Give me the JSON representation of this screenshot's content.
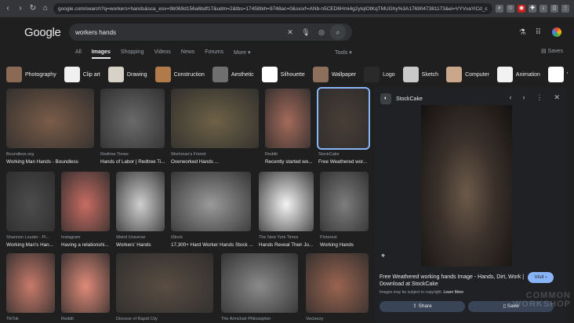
{
  "browser": {
    "url": "google.com/search?q=workers+hands&sca_esv=9b069d156a6bdf17&udm=2&tbs=17458bih=9748ac=0&sxsrf=ANb-n5CED6Hmi4g2yIqIOtKqTMUGhy%3A1769047381173&ei=VYVvaYiCd_ckPIP_pcCAo&ved=0ahUKEwjKx_"
  },
  "header": {
    "logo": "Google",
    "search_query": "workers hands"
  },
  "tabs": [
    "All",
    "Images",
    "Shopping",
    "Videos",
    "News",
    "Forums",
    "More"
  ],
  "tools_label": "Tools",
  "saves_label": "Saves",
  "chips": [
    {
      "label": "Photography",
      "color": "#8a6a55"
    },
    {
      "label": "Clip art",
      "color": "#f0f0f0"
    },
    {
      "label": "Drawing",
      "color": "#d6d2c8"
    },
    {
      "label": "Construction",
      "color": "#b07a4a"
    },
    {
      "label": "Aesthetic",
      "color": "#6f6f6f"
    },
    {
      "label": "Silhouette",
      "color": "#ffffff"
    },
    {
      "label": "Wallpaper",
      "color": "#8c6f5c"
    },
    {
      "label": "Logo",
      "color": "#2a2a2a"
    },
    {
      "label": "Sketch",
      "color": "#c9c9c9"
    },
    {
      "label": "Computer",
      "color": "#caa68a"
    },
    {
      "label": "Animation",
      "color": "#f2f2f2"
    },
    {
      "label": "Vecto",
      "color": "#ffffff"
    }
  ],
  "results": [
    {
      "source": "Boundless.org",
      "title": "Working Man Hands - Boundless",
      "color": "#7a5c48"
    },
    {
      "source": "Redtree Times",
      "title": "Hands of Labor | Redtree Ti...",
      "color": "#6a6a6a"
    },
    {
      "source": "Workman's Friend",
      "title": "Overworked Hands ...",
      "color": "#6e6146"
    },
    {
      "source": "Reddit",
      "title": "Recently started wo...",
      "color": "#a46a5a"
    },
    {
      "source": "StockCake",
      "title": "Free Weathered wor...",
      "color": "#4a3e36"
    },
    {
      "source": "Shannon Louder - Pi...",
      "title": "Working Man's Han...",
      "color": "#4c4c4c"
    },
    {
      "source": "Instagram",
      "title": "Having a relationshi...",
      "color": "#c86c62"
    },
    {
      "source": "Weird Universe",
      "title": "Workers' Hands",
      "color": "#cfcfcf"
    },
    {
      "source": "iStock",
      "title": "17,300+ Hard Worker Hands Stock ...",
      "color": "#9a9a9a"
    },
    {
      "source": "The New York Times",
      "title": "Hands Reveal Their Jo...",
      "color": "#f4f4f4"
    },
    {
      "source": "Pinterest",
      "title": "Working Hands",
      "color": "#7d7d7d"
    },
    {
      "source": "TikTok",
      "title": "",
      "color": "#c87a6a"
    },
    {
      "source": "Reddit",
      "title": "",
      "color": "#e08a78"
    },
    {
      "source": "Diocese of Rapid City",
      "title": "",
      "color": "#5a4d42"
    },
    {
      "source": "The Armchair Philosopher",
      "title": "",
      "color": "#8a8a8a"
    },
    {
      "source": "Vecteezy",
      "title": "",
      "color": "#9a6450"
    }
  ],
  "panel": {
    "source": "StockCake",
    "title": "Free Weathered working hands Image - Hands, Dirt, Work | Download at StockCake",
    "visit_label": "Visit",
    "note": "Images may be subject to copyright.",
    "learn_more": "Learn More",
    "share_label": "Share",
    "save_label": "Save"
  },
  "watermark": "COMMON WORKSHOP"
}
